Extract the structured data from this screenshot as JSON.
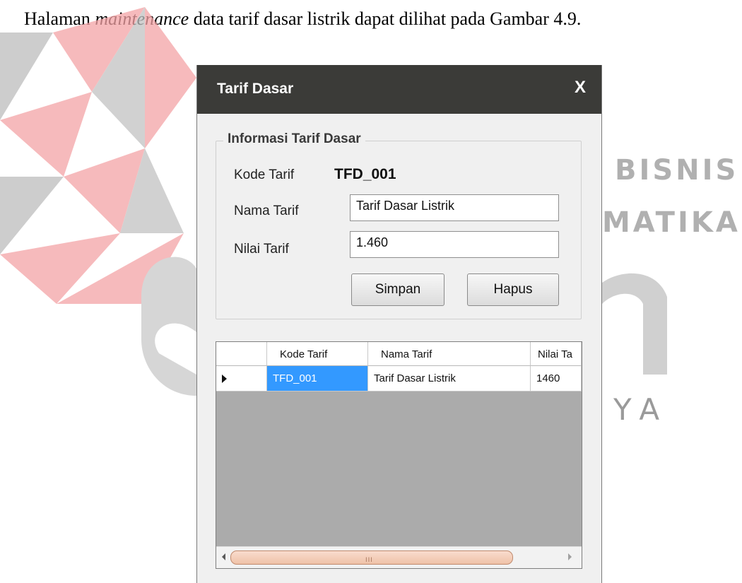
{
  "caption": {
    "before": "Halaman ",
    "emph": "maintenance",
    "after": " data tarif dasar listrik dapat dilihat pada Gambar 4.9."
  },
  "watermark": {
    "line1": "BISNIS",
    "line2": "MATIKA",
    "line3": "YA",
    "logo_colors": {
      "pink": "#f5a5a8",
      "gray": "#bdbdbd"
    }
  },
  "dialog": {
    "title": "Tarif Dasar",
    "close": "X",
    "group_title": "Informasi Tarif Dasar",
    "fields": {
      "kode_label": "Kode Tarif",
      "kode_value": "TFD_001",
      "nama_label": "Nama Tarif",
      "nama_value": "Tarif Dasar Listrik",
      "nilai_label": "Nilai Tarif",
      "nilai_value": "1.460"
    },
    "buttons": {
      "save": "Simpan",
      "delete": "Hapus"
    },
    "colors": {
      "titlebar": "#3b3b38",
      "selection": "#3399ff"
    }
  },
  "grid": {
    "columns": [
      "Kode Tarif",
      "Nama Tarif",
      "Nilai Ta"
    ],
    "rows": [
      {
        "kode": "TFD_001",
        "nama": "Tarif Dasar Listrik",
        "nilai": "1460"
      }
    ],
    "scroll_grip": "III"
  }
}
